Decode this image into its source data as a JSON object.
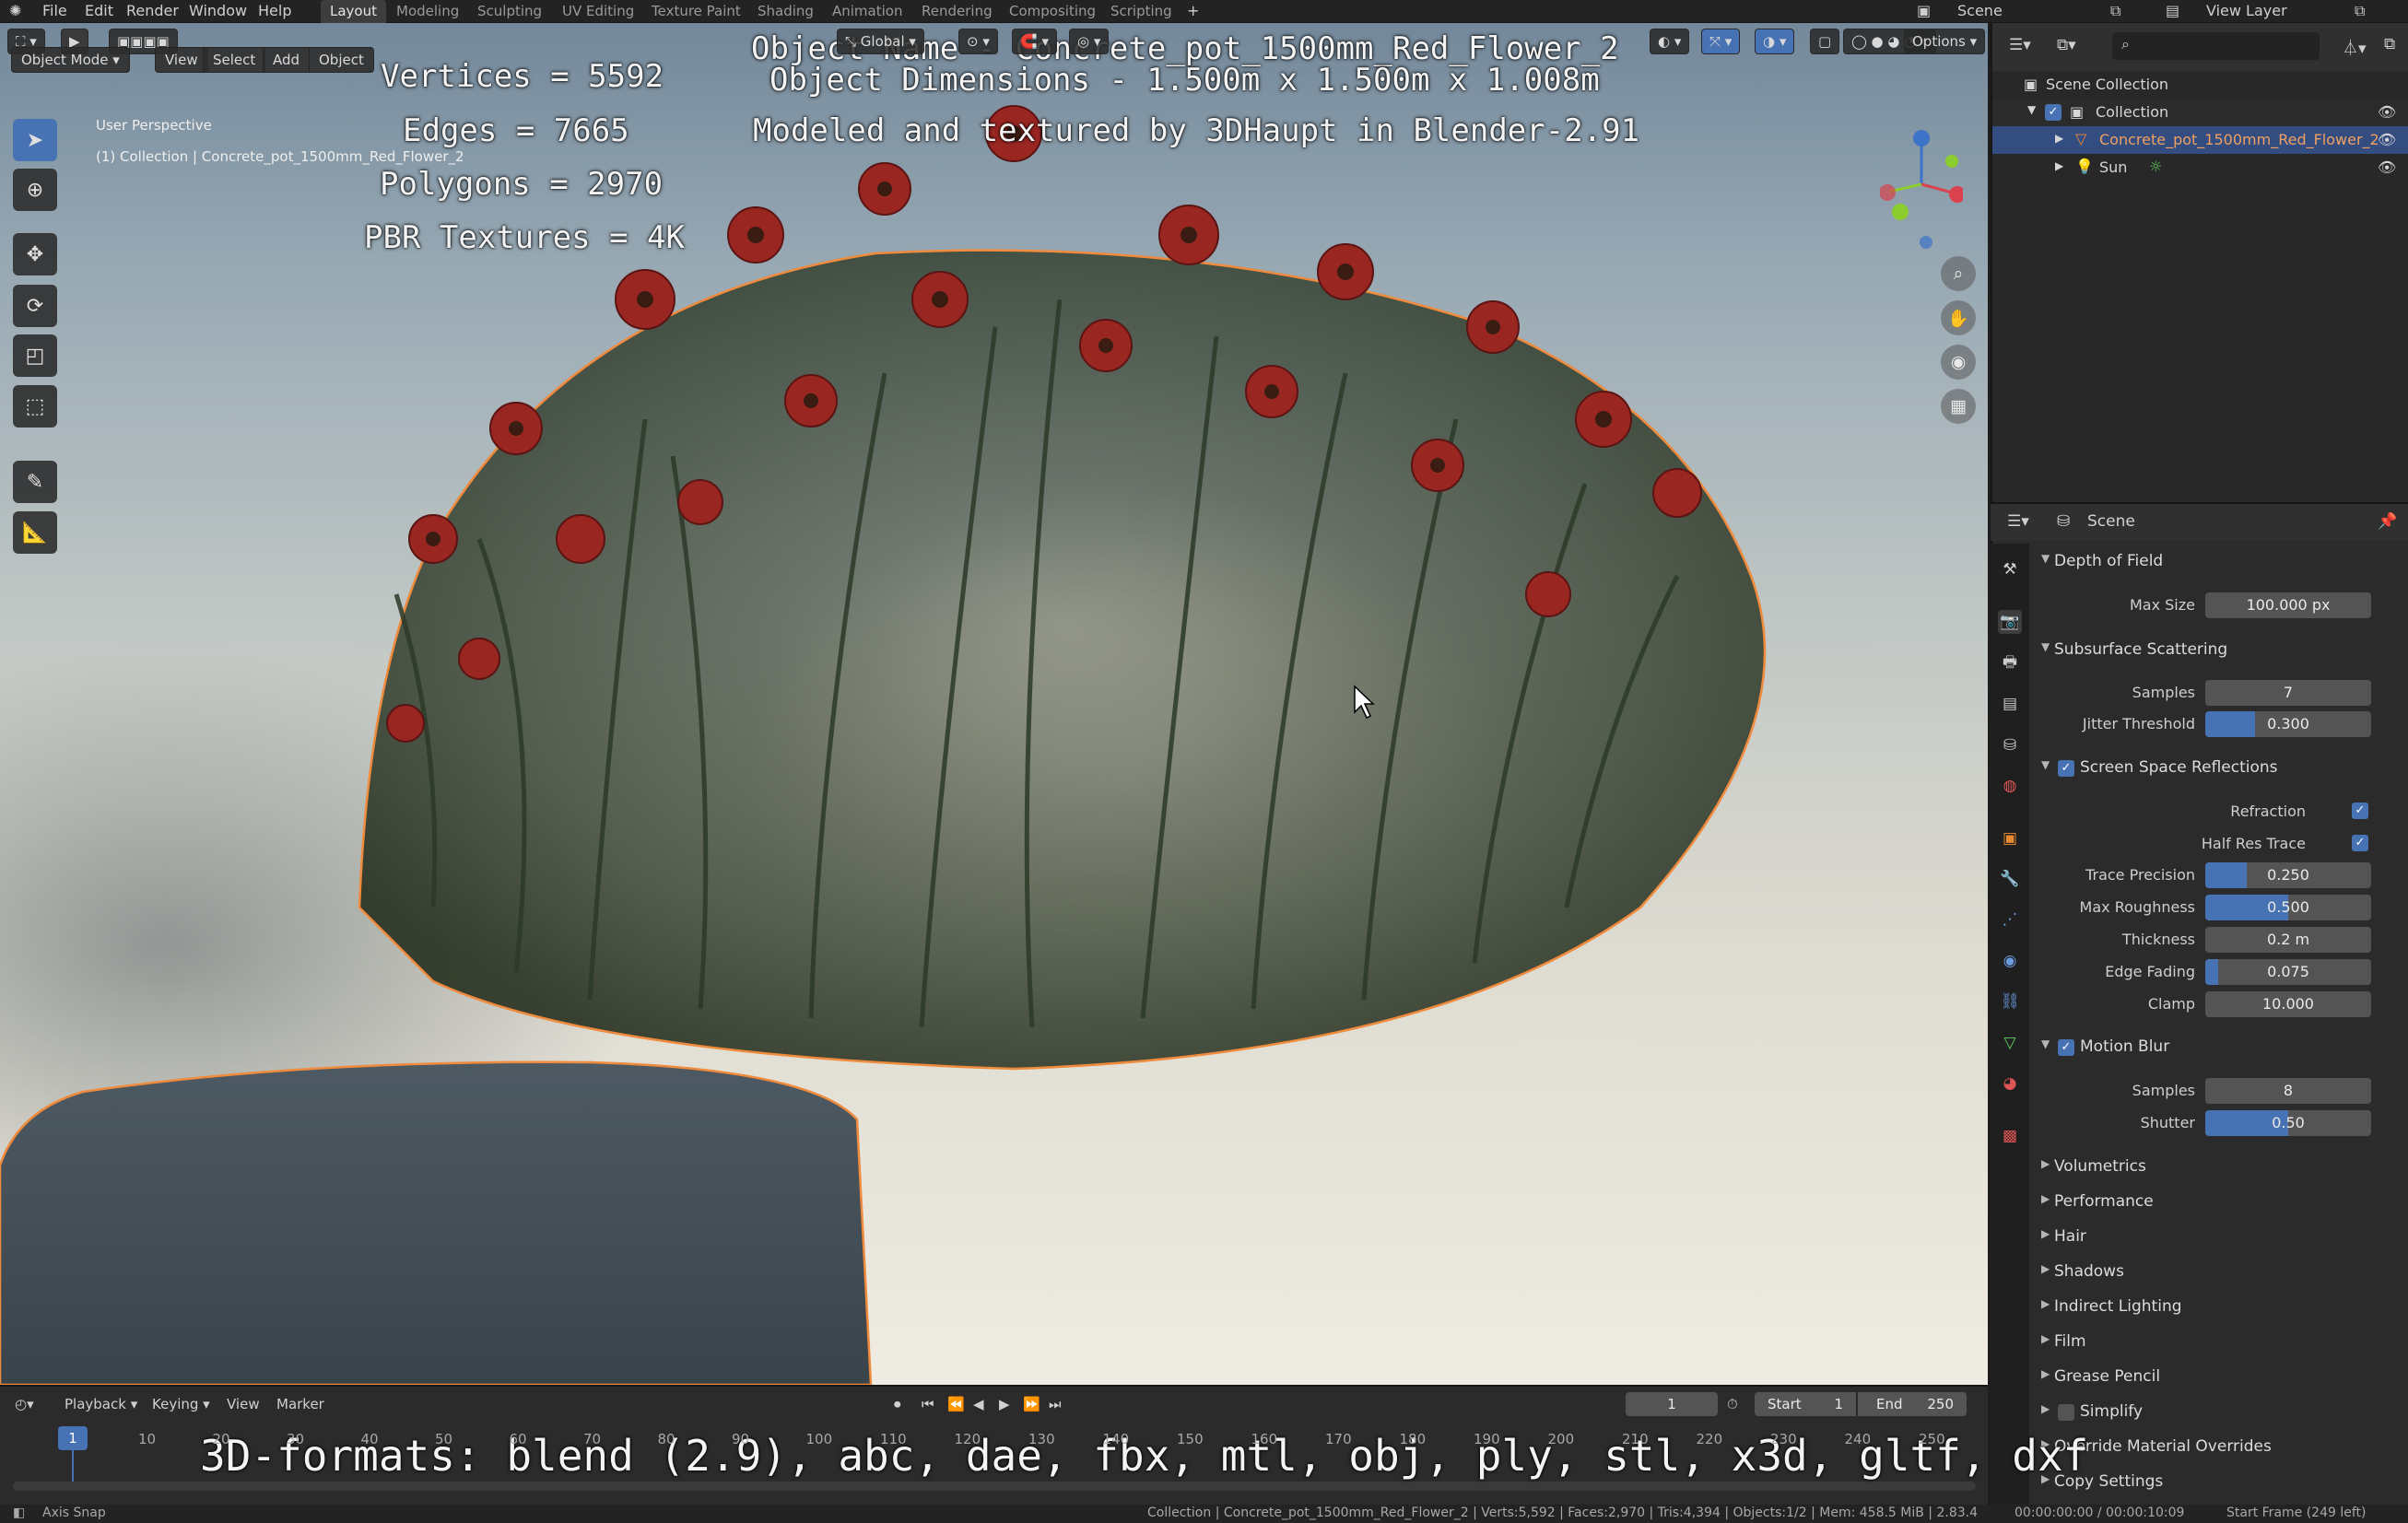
{
  "menu": {
    "items": [
      "File",
      "Edit",
      "Render",
      "Window",
      "Help"
    ],
    "workspaces": [
      "Layout",
      "Modeling",
      "Sculpting",
      "UV Editing",
      "Texture Paint",
      "Shading",
      "Animation",
      "Rendering",
      "Compositing",
      "Scripting"
    ],
    "active_workspace": "Layout",
    "scene_label": "Scene",
    "view_layer_label": "View Layer"
  },
  "viewport": {
    "mode": "Object Mode",
    "menus": [
      "View",
      "Select",
      "Add",
      "Object"
    ],
    "transform_orientation": "Global",
    "options_label": "Options",
    "perspective_label": "User Perspective",
    "collection_label": "(1) Collection | Concrete_pot_1500mm_Red_Flower_2"
  },
  "overlay": {
    "vertices": "Vertices = 5592",
    "edges": "Edges = 7665",
    "polygons": "Polygons = 2970",
    "textures": "PBR Textures = 4K",
    "object_name": "Object Name - Concrete_pot_1500mm_Red_Flower_2",
    "dimensions": "Object Dimensions -  1.500m x 1.500m x 1.008m",
    "credit": "Modeled and textured by 3DHaupt in Blender-2.91",
    "formats": "3D-formats: blend (2.9), abc, dae, fbx, mtl, obj, ply, stl, x3d, gltf, dxf"
  },
  "outliner": {
    "scene_collection": "Scene Collection",
    "collection": "Collection",
    "object": "Concrete_pot_1500mm_Red_Flower_2",
    "sun": "Sun"
  },
  "properties": {
    "header": "Scene",
    "depth_of_field": {
      "title": "Depth of Field",
      "max_size_label": "Max Size",
      "max_size": "100.000 px"
    },
    "subsurface": {
      "title": "Subsurface Scattering",
      "samples_label": "Samples",
      "samples": "7",
      "jitter_label": "Jitter Threshold",
      "jitter": "0.300",
      "jitter_fill": 0.3
    },
    "ssr": {
      "title": "Screen Space Reflections",
      "refraction_label": "Refraction",
      "half_res_label": "Half Res Trace",
      "trace_precision_label": "Trace Precision",
      "trace_precision": "0.250",
      "trace_precision_fill": 0.25,
      "max_roughness_label": "Max Roughness",
      "max_roughness": "0.500",
      "max_roughness_fill": 0.5,
      "thickness_label": "Thickness",
      "thickness": "0.2 m",
      "edge_fading_label": "Edge Fading",
      "edge_fading": "0.075",
      "edge_fading_fill": 0.075,
      "clamp_label": "Clamp",
      "clamp": "10.000"
    },
    "motion_blur": {
      "title": "Motion Blur",
      "samples_label": "Samples",
      "samples": "8",
      "shutter_label": "Shutter",
      "shutter": "0.50",
      "shutter_fill": 0.5
    },
    "collapsed": [
      "Volumetrics",
      "Performance",
      "Hair",
      "Shadows",
      "Indirect Lighting",
      "Film",
      "Grease Pencil",
      "Simplify",
      "Override Material Overrides",
      "Copy Settings"
    ]
  },
  "timeline": {
    "menus": [
      "Playback",
      "Keying",
      "View",
      "Marker"
    ],
    "current_frame": "1",
    "start_label": "Start",
    "start": "1",
    "end_label": "End",
    "end": "250",
    "ticks": [
      "1",
      "10",
      "20",
      "30",
      "40",
      "50",
      "60",
      "70",
      "80",
      "90",
      "100",
      "110",
      "120",
      "130",
      "140",
      "150",
      "160",
      "170",
      "180",
      "190",
      "200",
      "210",
      "220",
      "230",
      "240",
      "250"
    ]
  },
  "status": {
    "left": "Axis Snap",
    "center": "Collection | Concrete_pot_1500mm_Red_Flower_2 | Verts:5,592 | Faces:2,970 | Tris:4,394 | Objects:1/2 | Mem: 458.5 MiB | 2.83.4",
    "time": "00:00:00:00 / 00:00:10:09",
    "frame_info": "Start Frame (249 left)"
  }
}
